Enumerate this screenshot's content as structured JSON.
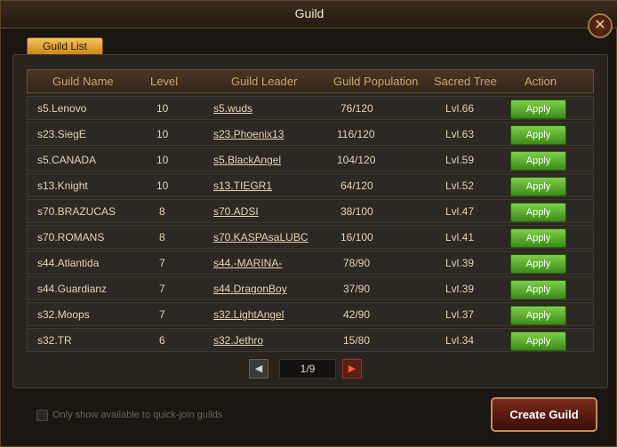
{
  "window": {
    "title": "Guild",
    "close_label": "✕"
  },
  "tabs": [
    {
      "label": "Guild List"
    }
  ],
  "table": {
    "columns": [
      "Guild Name",
      "Level",
      "Guild Leader",
      "Guild Population",
      "Sacred Tree",
      "Action"
    ],
    "rows": [
      {
        "name": "s5.Lenovo",
        "level": "10",
        "leader": "s5.wuds",
        "population": "76/120",
        "tree": "Lvl.66",
        "action": "Apply"
      },
      {
        "name": "s23.SiegE",
        "level": "10",
        "leader": "s23.Phoenix13",
        "population": "116/120",
        "tree": "Lvl.63",
        "action": "Apply"
      },
      {
        "name": "s5.CANADA",
        "level": "10",
        "leader": "s5.BlackAngel",
        "population": "104/120",
        "tree": "Lvl.59",
        "action": "Apply"
      },
      {
        "name": "s13.Knight",
        "level": "10",
        "leader": "s13.TIEGR1",
        "population": "64/120",
        "tree": "Lvl.52",
        "action": "Apply"
      },
      {
        "name": "s70.BRAZUCAS",
        "level": "8",
        "leader": "s70.ADSI",
        "population": "38/100",
        "tree": "Lvl.47",
        "action": "Apply"
      },
      {
        "name": "s70.ROMANS",
        "level": "8",
        "leader": "s70.KASPAsaLUBC",
        "population": "16/100",
        "tree": "Lvl.41",
        "action": "Apply"
      },
      {
        "name": "s44.Atlantida",
        "level": "7",
        "leader": "s44.-MARINA-",
        "population": "78/90",
        "tree": "Lvl.39",
        "action": "Apply"
      },
      {
        "name": "s44.Guardianz",
        "level": "7",
        "leader": "s44.DragonBoy",
        "population": "37/90",
        "tree": "Lvl.39",
        "action": "Apply"
      },
      {
        "name": "s32.Moops",
        "level": "7",
        "leader": "s32.LightAngel",
        "population": "42/90",
        "tree": "Lvl.37",
        "action": "Apply"
      },
      {
        "name": "s32.TR",
        "level": "6",
        "leader": "s32.Jethro",
        "population": "15/80",
        "tree": "Lvl.34",
        "action": "Apply"
      }
    ]
  },
  "pagination": {
    "prev_icon": "◀",
    "next_icon": "▶",
    "page_text": "1/9"
  },
  "footer": {
    "quick_join_label": "Only show available to quick-join guilds",
    "quick_join_checked": false,
    "create_label": "Create Guild"
  },
  "colors": {
    "apply_green": "#5cb030",
    "tab_gold": "#e0a43a",
    "header_text": "#c9a66b"
  }
}
